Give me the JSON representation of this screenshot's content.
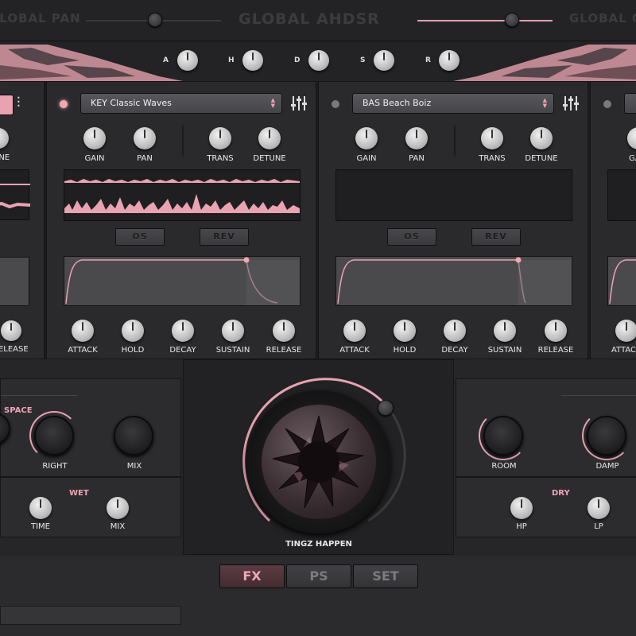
{
  "top": {
    "left_label": "GLOBAL PAN",
    "center_label": "GLOBAL AHDSR",
    "right_label": "GLOBAL G"
  },
  "global_ahdsr_knobs": [
    "A",
    "H",
    "D",
    "S",
    "R"
  ],
  "layers": [
    {
      "preset": "KEY Classic Waves",
      "led": "on",
      "knobs": [
        "GAIN",
        "PAN",
        "TRANS",
        "DETUNE"
      ],
      "buttons": [
        "OS",
        "REV"
      ],
      "env_knobs": [
        "ATTACK",
        "HOLD",
        "DECAY",
        "SUSTAIN",
        "RELEASE"
      ]
    },
    {
      "preset": "BAS Beach Boiz",
      "led": "off",
      "knobs": [
        "GAIN",
        "PAN",
        "TRANS",
        "DETUNE"
      ],
      "buttons": [
        "OS",
        "REV"
      ],
      "env_knobs": [
        "ATTACK",
        "HOLD",
        "DECAY",
        "SUSTAIN",
        "RELEASE"
      ]
    }
  ],
  "left_partial": {
    "knob_label": "UNE",
    "env_label": "RELEASE"
  },
  "right_partial": {
    "knob_label": "GA",
    "env_label": "ATTAC"
  },
  "fx": {
    "space_title": "SPACE",
    "space_knobs": [
      "RIGHT",
      "MIX"
    ],
    "wet_title": "WET",
    "wet_knobs": [
      "TIME",
      "MIX"
    ],
    "center_label": "TINGZ HAPPEN",
    "reverb_knobs": [
      "ROOM",
      "DAMP"
    ],
    "dry_title": "DRY",
    "dry_knobs": [
      "HP",
      "LP"
    ]
  },
  "tabs": [
    {
      "label": "FX",
      "active": true
    },
    {
      "label": "PS",
      "active": false
    },
    {
      "label": "SET",
      "active": false
    }
  ],
  "colors": {
    "accent": "#f0a3b2",
    "panel": "#2a2a2d",
    "background": "#1c1c1e"
  }
}
